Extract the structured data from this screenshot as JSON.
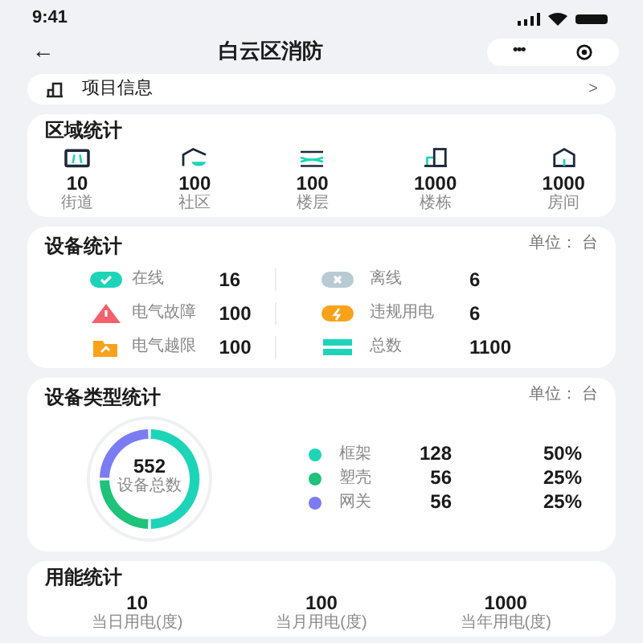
{
  "status_bar": {
    "time": "9:41"
  },
  "nav": {
    "back": "←",
    "title": "白云区消防",
    "more": "•••"
  },
  "project": {
    "label": "项目信息",
    "chevron": ">"
  },
  "region": {
    "title": "区域统计",
    "items": [
      {
        "kind": "street",
        "value": "10",
        "label": "街道"
      },
      {
        "kind": "community",
        "value": "100",
        "label": "社区"
      },
      {
        "kind": "floor",
        "value": "100",
        "label": "楼层"
      },
      {
        "kind": "building",
        "value": "1000",
        "label": "楼栋"
      },
      {
        "kind": "room",
        "value": "1000",
        "label": "房间"
      }
    ]
  },
  "devices": {
    "title": "设备统计",
    "unit": "单位： 台",
    "items": [
      {
        "kind": "online",
        "color": "#1ed4b8",
        "label": "在线",
        "value": "16"
      },
      {
        "kind": "offline",
        "color": "#b8cad4",
        "label": "离线",
        "value": "6"
      },
      {
        "kind": "fault",
        "color": "#f4606c",
        "label": "电气故障",
        "value": "100"
      },
      {
        "kind": "violation",
        "color": "#f8a21b",
        "label": "违规用电",
        "value": "6"
      },
      {
        "kind": "overlimit",
        "color": "#f8a21b",
        "label": "电气越限",
        "value": "100"
      },
      {
        "kind": "total",
        "color": "#1ed4b8",
        "label": "总数",
        "value": "1100"
      }
    ]
  },
  "device_types": {
    "title": "设备类型统计",
    "unit": "单位： 台",
    "total": "552",
    "total_label": "设备总数",
    "chart_data": {
      "type": "donut",
      "categories": [
        "框架",
        "塑壳",
        "网关"
      ],
      "series": [
        {
          "values": [
            50,
            25,
            25
          ]
        }
      ]
    },
    "legend": [
      {
        "color": "#1ed4b8",
        "count": "128",
        "share": "50%"
      },
      {
        "color": "#1fc27a",
        "count": "56",
        "share": "25%"
      },
      {
        "color": "#7b7cf2",
        "count": "56",
        "share": "25%"
      }
    ]
  },
  "energy": {
    "title": "用能统计",
    "items": [
      {
        "value": "10",
        "label": "当日用电(度)"
      },
      {
        "value": "100",
        "label": "当月用电(度)"
      },
      {
        "value": "1000",
        "label": "当年用电(度)"
      }
    ]
  }
}
